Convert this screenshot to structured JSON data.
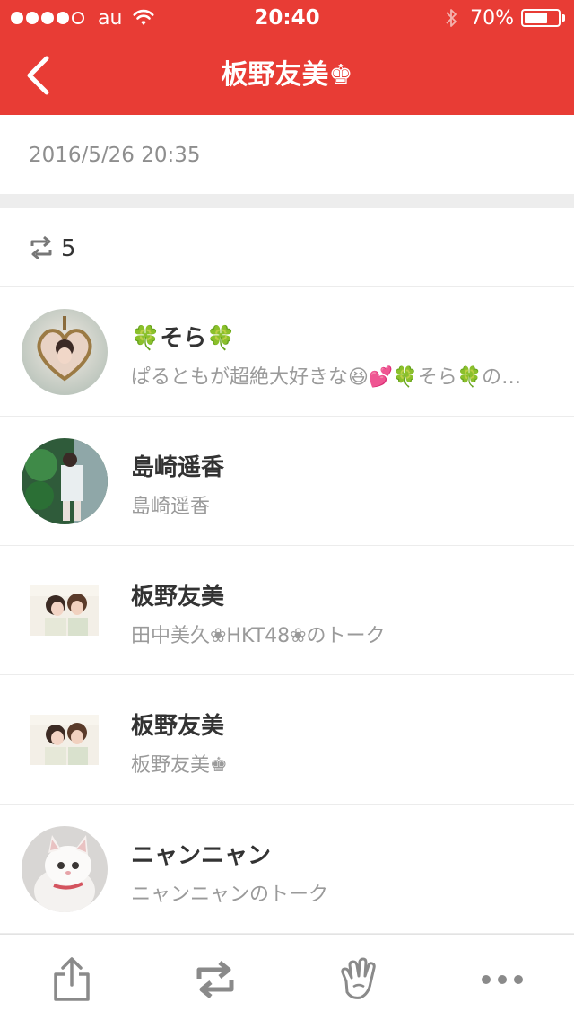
{
  "status_bar": {
    "carrier": "au",
    "time": "20:40",
    "battery": "70%",
    "battery_level": 0.7,
    "signal_bars_filled": 4,
    "signal_bars_total": 5
  },
  "nav": {
    "title": "板野友美♚",
    "back_icon": "chevron-left-icon"
  },
  "post": {
    "timestamp": "2016/5/26 20:35",
    "repost_count": "5"
  },
  "reposters": [
    {
      "name": "🍀そら🍀",
      "subtitle": "ぱるともが超絶大好きな😆💕🍀そら🍀の…",
      "avatar": "heart-locket-photo"
    },
    {
      "name": "島崎遥香",
      "subtitle": "島崎遥香",
      "avatar": "outdoor-portrait-photo"
    },
    {
      "name": "板野友美",
      "subtitle": "田中美久❀HKT48❀のトーク",
      "avatar": "two-girls-photo"
    },
    {
      "name": "板野友美",
      "subtitle": "板野友美♚",
      "avatar": "two-girls-photo"
    },
    {
      "name": "ニャンニャン",
      "subtitle": "ニャンニャンのトーク",
      "avatar": "white-kitten-photo"
    }
  ],
  "toolbar": {
    "items": [
      "share-icon",
      "repost-icon",
      "clap-hand-icon",
      "more-icon"
    ]
  },
  "colors": {
    "accent": "#e83c35",
    "text_primary": "#333333",
    "text_secondary": "#9a9a9a",
    "separator": "#ededed"
  }
}
